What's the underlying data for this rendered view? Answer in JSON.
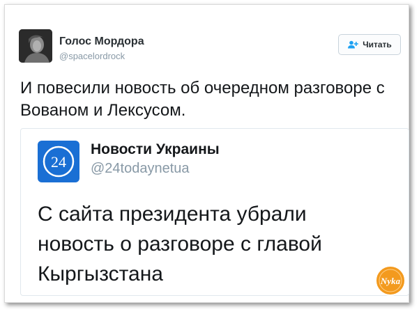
{
  "tweet": {
    "author": {
      "name": "Голос Мордора",
      "handle": "@spacelordrock"
    },
    "follow_button": {
      "label": "Читать",
      "icon": "add-user-icon"
    },
    "text": "И повесили новость об очередном разговоре с Вованом и Лексусом."
  },
  "quoted": {
    "author": {
      "name": "Новости Украины",
      "handle": "@24todaynetua"
    },
    "logo": {
      "text": "24",
      "color": "#1a6fd4"
    },
    "text": "С сайта президента убрали новость о разговоре с главой Кыргызстана"
  },
  "watermark": {
    "text": "Nyka",
    "color": "#f39a1e"
  },
  "colors": {
    "accent": "#1da1f2",
    "text": "#14171a",
    "secondary_text": "#8899a6"
  }
}
